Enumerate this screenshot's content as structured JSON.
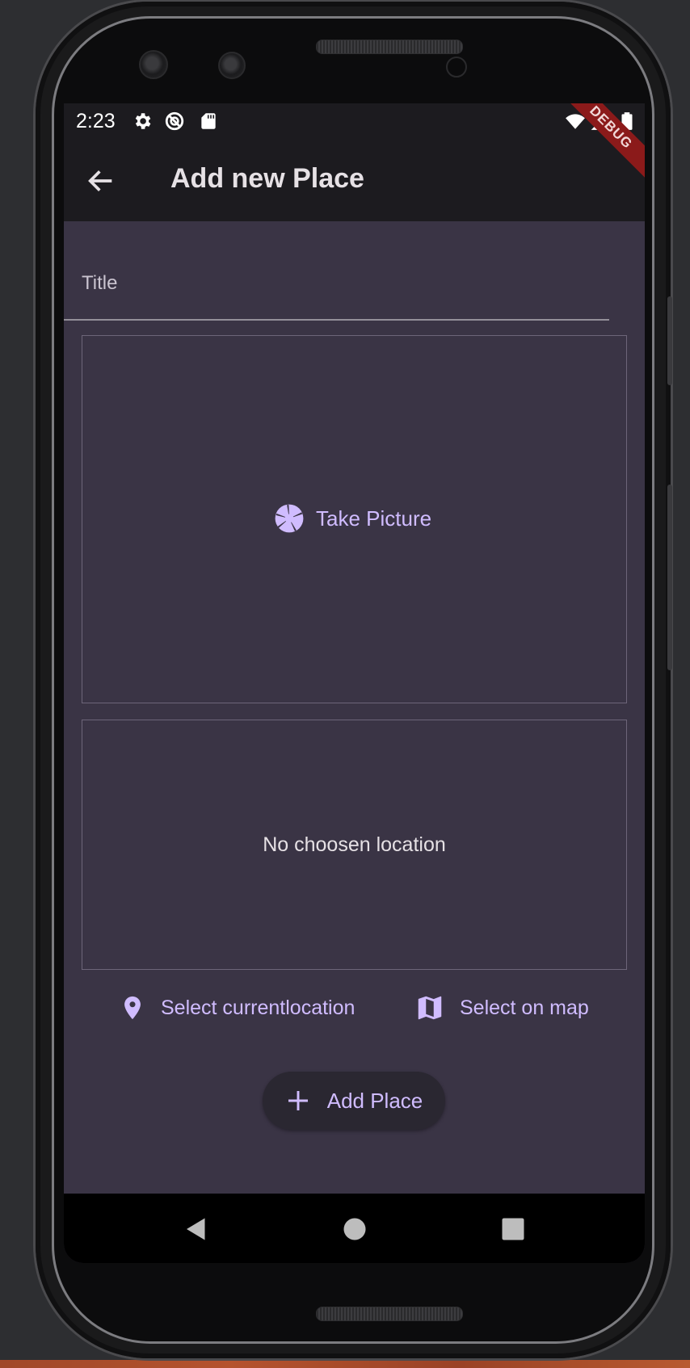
{
  "status_bar": {
    "time": "2:23",
    "icons": [
      "settings-icon",
      "no-disturb-icon",
      "sd-card-icon",
      "wifi-icon",
      "signal-icon",
      "battery-icon"
    ]
  },
  "debug_banner": "DEBUG",
  "app_bar": {
    "title": "Add new Place",
    "back_icon": "arrow-back-icon"
  },
  "form": {
    "title_placeholder": "Title",
    "title_value": "",
    "take_picture_label": "Take Picture",
    "no_location_text": "No choosen location",
    "select_current_location_label": "Select currentlocation",
    "select_on_map_label": "Select on map",
    "add_place_label": "Add Place"
  },
  "nav_bar": {
    "buttons": [
      "back-triangle-icon",
      "home-circle-icon",
      "recents-square-icon"
    ]
  },
  "colors": {
    "screen_bg": "#3a3445",
    "app_bar_bg": "#1c1b1f",
    "accent": "#d0bcff",
    "text": "#e6e1e5",
    "debug_banner": "#8b1a1a"
  }
}
